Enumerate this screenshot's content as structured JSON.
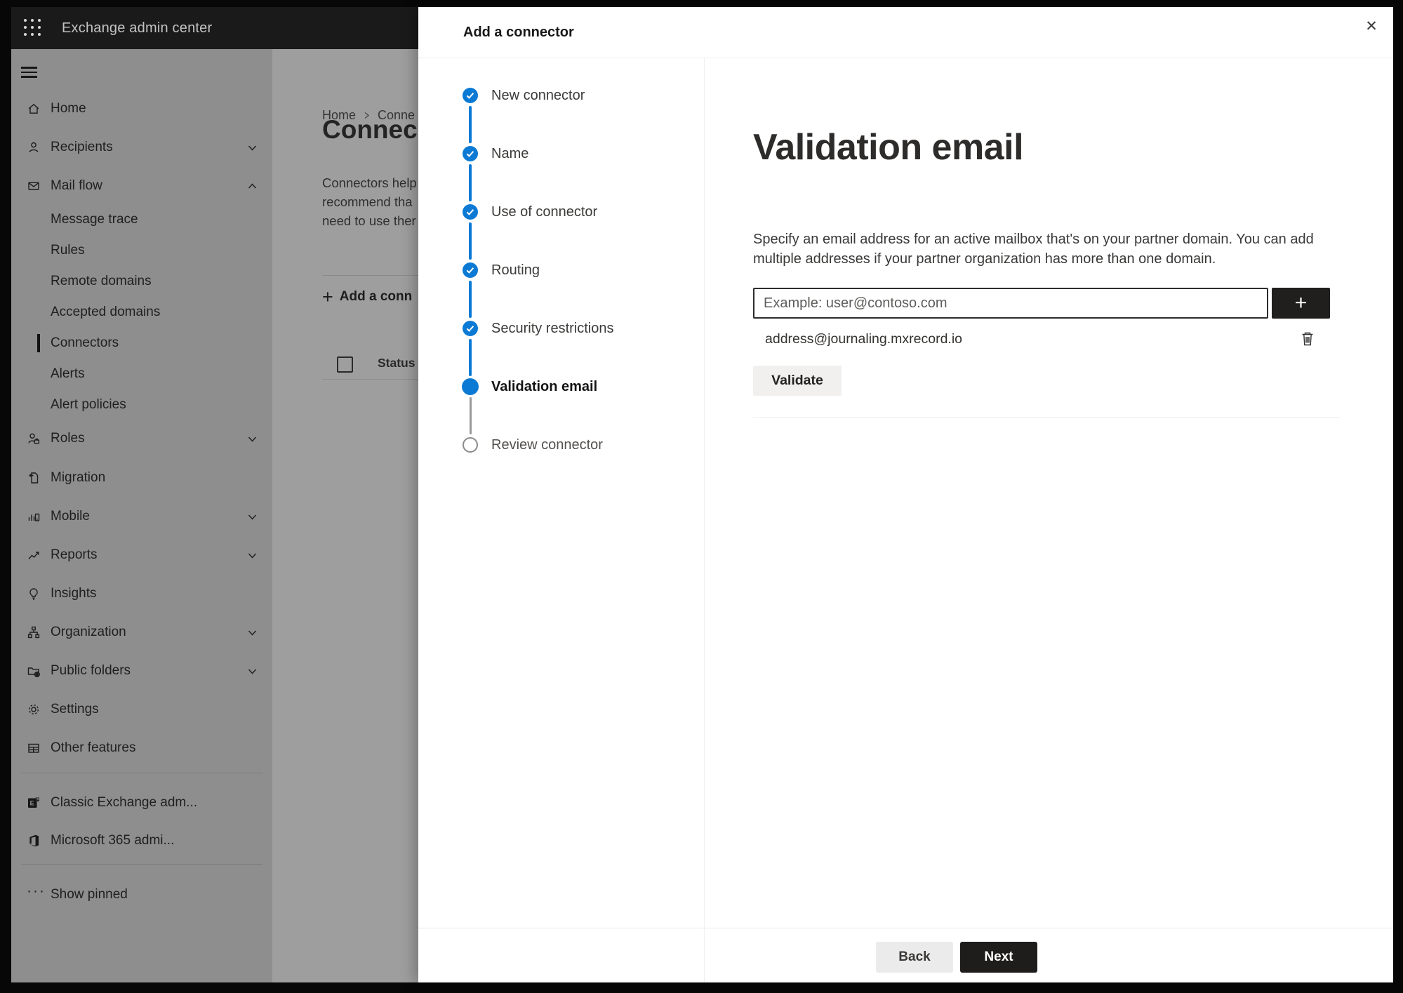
{
  "topbar": {
    "title": "Exchange admin center"
  },
  "sidebar": {
    "items": [
      {
        "label": "Home",
        "icon": "home-icon"
      },
      {
        "label": "Recipients",
        "icon": "person-icon",
        "chevron": "down"
      },
      {
        "label": "Mail flow",
        "icon": "mail-icon",
        "chevron": "up",
        "expanded": true
      },
      {
        "label": "Message trace",
        "indent": true
      },
      {
        "label": "Rules",
        "indent": true
      },
      {
        "label": "Remote domains",
        "indent": true
      },
      {
        "label": "Accepted domains",
        "indent": true
      },
      {
        "label": "Connectors",
        "indent": true,
        "selected": true
      },
      {
        "label": "Alerts",
        "indent": true
      },
      {
        "label": "Alert policies",
        "indent": true
      },
      {
        "label": "Roles",
        "icon": "roles-icon",
        "chevron": "down"
      },
      {
        "label": "Migration",
        "icon": "migration-icon"
      },
      {
        "label": "Mobile",
        "icon": "mobile-icon",
        "chevron": "down"
      },
      {
        "label": "Reports",
        "icon": "reports-icon",
        "chevron": "down"
      },
      {
        "label": "Insights",
        "icon": "lightbulb-icon"
      },
      {
        "label": "Organization",
        "icon": "org-chart-icon",
        "chevron": "down"
      },
      {
        "label": "Public folders",
        "icon": "folder-globe-icon",
        "chevron": "down"
      },
      {
        "label": "Settings",
        "icon": "gear-icon"
      },
      {
        "label": "Other features",
        "icon": "grid-table-icon"
      },
      {
        "label": "Classic Exchange adm...",
        "icon": "exchange-logo-icon"
      },
      {
        "label": "Microsoft 365 admi...",
        "icon": "microsoft365-logo-icon"
      },
      {
        "label": "Show pinned",
        "icon": "ellipsis-icon"
      }
    ]
  },
  "page": {
    "breadcrumb": {
      "home": "Home",
      "current": "Conne"
    },
    "title": "Connec",
    "intro_lines": [
      "Connectors help",
      "recommend tha",
      "need to use ther"
    ],
    "add_connector_label": "Add a conn",
    "status_column": "Status"
  },
  "modal": {
    "title": "Add a connector",
    "close_label": "✕",
    "steps": [
      {
        "label": "New connector",
        "state": "completed"
      },
      {
        "label": "Name",
        "state": "completed"
      },
      {
        "label": "Use of connector",
        "state": "completed"
      },
      {
        "label": "Routing",
        "state": "completed"
      },
      {
        "label": "Security restrictions",
        "state": "completed"
      },
      {
        "label": "Validation email",
        "state": "current"
      },
      {
        "label": "Review connector",
        "state": "upcoming"
      }
    ],
    "content": {
      "heading": "Validation email",
      "description_line1": "Specify an email address for an active mailbox that's on your partner domain. You can add",
      "description_line2": "multiple addresses if your partner organization has more than one domain.",
      "email_input_value": "",
      "email_input_placeholder": "Example: user@contoso.com",
      "add_address_label": "+",
      "added_addresses": [
        "address@journaling.mxrecord.io"
      ],
      "validate_button": "Validate"
    },
    "footer": {
      "back_button": "Back",
      "next_button": "Next"
    }
  },
  "colors": {
    "accent_blue": "#0b7ad4",
    "primary_button": "#1e1d1c",
    "scrim_sidebar": "#8e8e8e",
    "scrim_content": "#9e9e9e"
  }
}
